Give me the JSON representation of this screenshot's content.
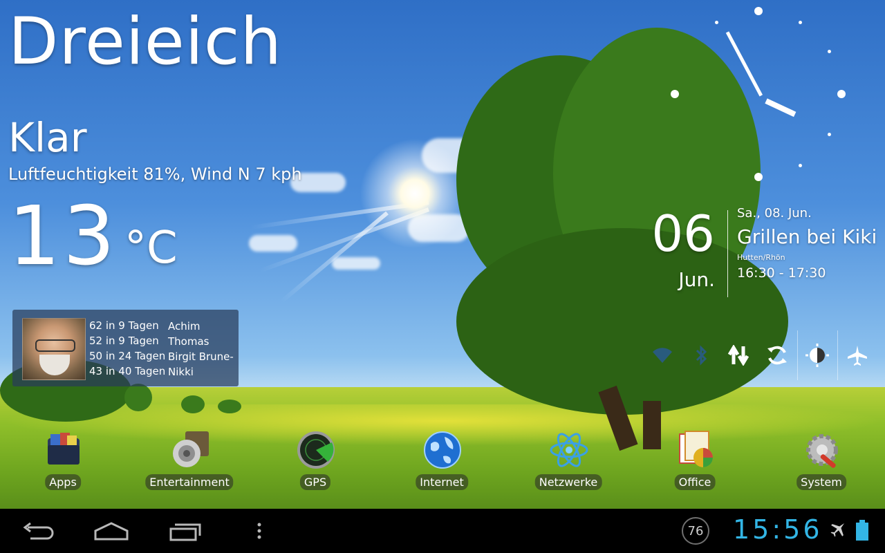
{
  "weather": {
    "city": "Dreieich",
    "condition": "Klar",
    "details": "Luftfeuchtigkeit 81%, Wind N 7 kph",
    "temperature": "13",
    "unit": "°C"
  },
  "contacts_widget": {
    "rows": [
      {
        "count": "62 in 9 Tagen",
        "name": "Achim"
      },
      {
        "count": "52 in 9 Tagen",
        "name": "Thomas"
      },
      {
        "count": "50 in 24 Tagen",
        "name": "Birgit Brune-"
      },
      {
        "count": "43 in 40 Tagen",
        "name": "Nikki"
      }
    ]
  },
  "calendar": {
    "day": "06",
    "month": "Jun.",
    "date": "Sa., 08. Jun.",
    "event": "Grillen bei Kiki",
    "place": "Hutten/Rhön",
    "time": "16:30 - 17:30"
  },
  "toggles": [
    {
      "icon": "wifi-icon",
      "state": "off"
    },
    {
      "icon": "bluetooth-icon",
      "state": "off"
    },
    {
      "icon": "data-transfer-icon",
      "state": "on"
    },
    {
      "icon": "sync-icon",
      "state": "on"
    },
    {
      "icon": "brightness-icon",
      "state": "on"
    },
    {
      "icon": "airplane-icon",
      "state": "on"
    }
  ],
  "dock": [
    {
      "label": "Apps",
      "icon": "apps-folder-icon"
    },
    {
      "label": "Entertainment",
      "icon": "speaker-film-icon"
    },
    {
      "label": "GPS",
      "icon": "radar-icon"
    },
    {
      "label": "Internet",
      "icon": "globe-icon"
    },
    {
      "label": "Netzwerke",
      "icon": "atom-icon"
    },
    {
      "label": "Office",
      "icon": "office-documents-icon"
    },
    {
      "label": "System",
      "icon": "gear-wrench-icon"
    }
  ],
  "navbar": {
    "back_icon": "back-icon",
    "home_icon": "home-icon",
    "recents_icon": "recent-apps-icon",
    "menu_icon": "menu-dots-icon",
    "notification_badge": "76",
    "time": "15:56",
    "accent_color": "#33b5e5"
  }
}
